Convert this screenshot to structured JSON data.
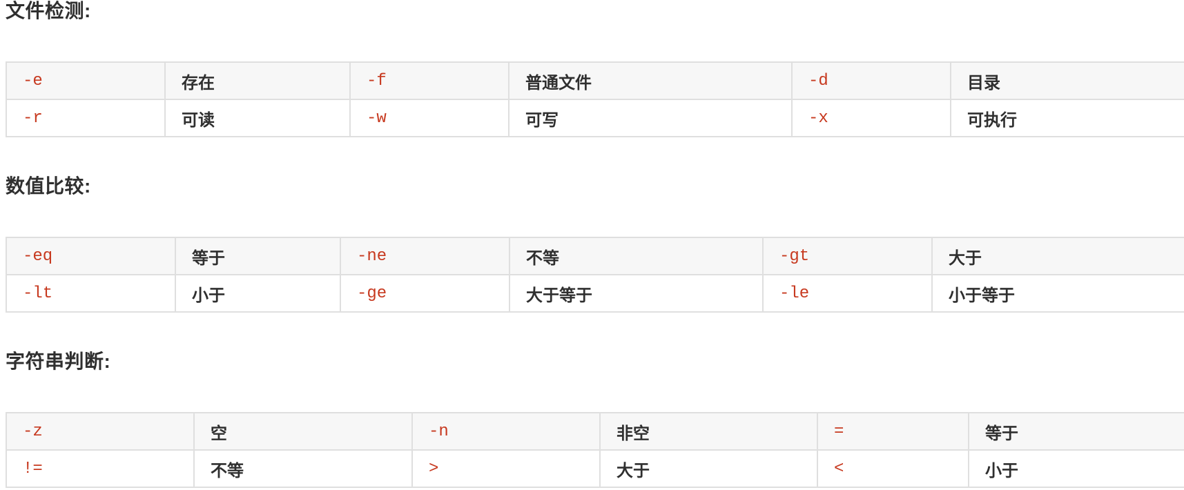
{
  "sections": [
    {
      "title": "文件检测:",
      "rows": [
        [
          {
            "code": "-e"
          },
          {
            "desc": "存在"
          },
          {
            "code": "-f"
          },
          {
            "desc": "普通文件"
          },
          {
            "code": "-d"
          },
          {
            "desc": "目录"
          }
        ],
        [
          {
            "code": "-r"
          },
          {
            "desc": "可读"
          },
          {
            "code": "-w"
          },
          {
            "desc": "可写"
          },
          {
            "code": "-x"
          },
          {
            "desc": "可执行"
          }
        ]
      ]
    },
    {
      "title": "数值比较:",
      "rows": [
        [
          {
            "code": "-eq"
          },
          {
            "desc": "等于"
          },
          {
            "code": "-ne"
          },
          {
            "desc": "不等"
          },
          {
            "code": "-gt"
          },
          {
            "desc": "大于"
          }
        ],
        [
          {
            "code": "-lt"
          },
          {
            "desc": "小于"
          },
          {
            "code": "-ge"
          },
          {
            "desc": "大于等于"
          },
          {
            "code": "-le"
          },
          {
            "desc": "小于等于"
          }
        ]
      ]
    },
    {
      "title": "字符串判断:",
      "rows": [
        [
          {
            "code": "-z"
          },
          {
            "desc": "空"
          },
          {
            "code": "-n"
          },
          {
            "desc": "非空"
          },
          {
            "code": "="
          },
          {
            "desc": "等于"
          }
        ],
        [
          {
            "code": "!="
          },
          {
            "desc": "不等"
          },
          {
            "code": ">"
          },
          {
            "desc": "大于"
          },
          {
            "code": "<"
          },
          {
            "desc": "小于"
          }
        ]
      ]
    }
  ],
  "colors": {
    "code_text": "#c7391f",
    "desc_text": "#2f2f2f",
    "header_row_bg": "#f7f7f7",
    "border": "#dfdfdf"
  }
}
